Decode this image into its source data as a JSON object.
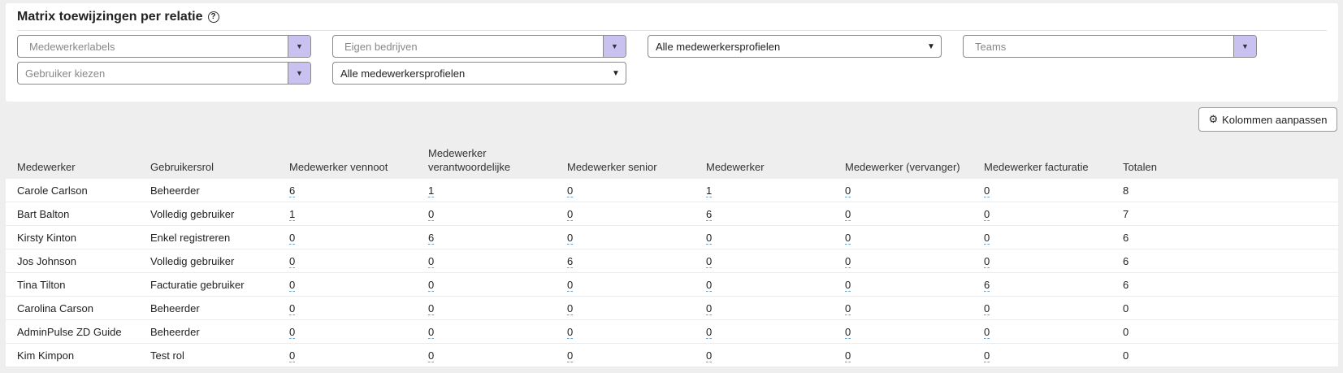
{
  "header": {
    "title": "Matrix toewijzingen per relatie",
    "help_icon": "?"
  },
  "filters": {
    "medewerkerlabels": "Medewerkerlabels",
    "eigen_bedrijven": "Eigen bedrijven",
    "profielen_1": "Alle medewerkersprofielen",
    "teams": "Teams",
    "gebruiker": "Gebruiker kiezen",
    "profielen_2": "Alle medewerkersprofielen"
  },
  "toolbar": {
    "columns_label": "Kolommen aanpassen",
    "columns_icon": "gear-icon"
  },
  "table": {
    "headers": [
      "Medewerker",
      "Gebruikersrol",
      "Medewerker vennoot",
      "Medewerker verantwoordelijke",
      "Medewerker senior",
      "Medewerker",
      "Medewerker (vervanger)",
      "Medewerker facturatie",
      "Totalen"
    ],
    "rows": [
      [
        "Carole Carlson",
        "Beheerder",
        "6",
        "1",
        "0",
        "1",
        "0",
        "0",
        "8"
      ],
      [
        "Bart Balton",
        "Volledig gebruiker",
        "1",
        "0",
        "0",
        "6",
        "0",
        "0",
        "7"
      ],
      [
        "Kirsty Kinton",
        "Enkel registreren",
        "0",
        "6",
        "0",
        "0",
        "0",
        "0",
        "6"
      ],
      [
        "Jos Johnson",
        "Volledig gebruiker",
        "0",
        "0",
        "6",
        "0",
        "0",
        "0",
        "6"
      ],
      [
        "Tina Tilton",
        "Facturatie gebruiker",
        "0",
        "0",
        "0",
        "0",
        "0",
        "6",
        "6"
      ],
      [
        "Carolina Carson",
        "Beheerder",
        "0",
        "0",
        "0",
        "0",
        "0",
        "0",
        "0"
      ],
      [
        "AdminPulse ZD Guide",
        "Beheerder",
        "0",
        "0",
        "0",
        "0",
        "0",
        "0",
        "0"
      ],
      [
        "Kim Kimpon",
        "Test rol",
        "0",
        "0",
        "0",
        "0",
        "0",
        "0",
        "0"
      ]
    ]
  },
  "colors": {
    "accent_button": "#c9c1f0",
    "link_underline": "#6aa0c8"
  }
}
